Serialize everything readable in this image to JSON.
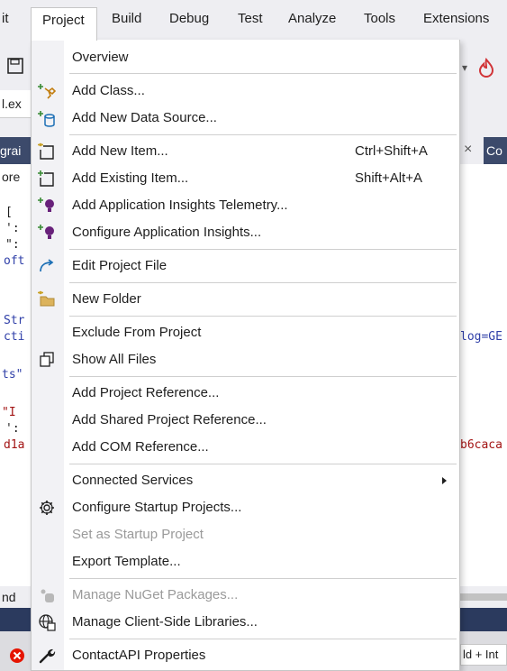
{
  "menubar": {
    "items": [
      "it",
      "Project",
      "Build",
      "Debug",
      "Test",
      "Analyze",
      "Tools",
      "Extensions"
    ],
    "active": "Project"
  },
  "background": {
    "tab_fragment": "l.ex",
    "gra_fragment": "grai",
    "ore_fragment": "ore",
    "right_tab": "Co",
    "code_left": [
      "[",
      "':",
      "\":",
      "oft",
      "Str",
      "cti",
      "ts\"",
      " \"I",
      "':",
      "d1a"
    ],
    "code_right": [
      "log=GE",
      "b6caca"
    ],
    "nd": "nd",
    "bottom_right": "ld + Int"
  },
  "menu": {
    "items": [
      {
        "label": "Overview",
        "icon": "none",
        "shortcut": "",
        "disabled": false
      },
      {
        "label": "Add Class...",
        "icon": "add-class-icon",
        "shortcut": "",
        "disabled": false
      },
      {
        "label": "Add New Data Source...",
        "icon": "add-data-source-icon",
        "shortcut": "",
        "disabled": false
      },
      {
        "label": "Add New Item...",
        "icon": "add-new-item-icon",
        "shortcut": "Ctrl+Shift+A",
        "disabled": false
      },
      {
        "label": "Add Existing Item...",
        "icon": "add-existing-item-icon",
        "shortcut": "Shift+Alt+A",
        "disabled": false
      },
      {
        "label": "Add Application Insights Telemetry...",
        "icon": "app-insights-icon",
        "shortcut": "",
        "disabled": false
      },
      {
        "label": "Configure Application Insights...",
        "icon": "app-insights-config-icon",
        "shortcut": "",
        "disabled": false
      },
      {
        "label": "Edit Project File",
        "icon": "edit-project-file-icon",
        "shortcut": "",
        "disabled": false
      },
      {
        "label": "New Folder",
        "icon": "new-folder-icon",
        "shortcut": "",
        "disabled": false
      },
      {
        "label": "Exclude From Project",
        "icon": "none",
        "shortcut": "",
        "disabled": false
      },
      {
        "label": "Show All Files",
        "icon": "show-all-files-icon",
        "shortcut": "",
        "disabled": false
      },
      {
        "label": "Add Project Reference...",
        "icon": "none",
        "shortcut": "",
        "disabled": false
      },
      {
        "label": "Add Shared Project Reference...",
        "icon": "none",
        "shortcut": "",
        "disabled": false
      },
      {
        "label": "Add COM Reference...",
        "icon": "none",
        "shortcut": "",
        "disabled": false
      },
      {
        "label": "Connected Services",
        "icon": "none",
        "shortcut": "",
        "disabled": false,
        "submenu": true
      },
      {
        "label": "Configure Startup Projects...",
        "icon": "gear-icon",
        "shortcut": "",
        "disabled": false
      },
      {
        "label": "Set as Startup Project",
        "icon": "none",
        "shortcut": "",
        "disabled": true
      },
      {
        "label": "Export Template...",
        "icon": "none",
        "shortcut": "",
        "disabled": false
      },
      {
        "label": "Manage NuGet Packages...",
        "icon": "nuget-icon",
        "shortcut": "",
        "disabled": true
      },
      {
        "label": "Manage Client-Side Libraries...",
        "icon": "client-libraries-icon",
        "shortcut": "",
        "disabled": false
      },
      {
        "label": "ContactAPI Properties",
        "icon": "wrench-icon",
        "shortcut": "",
        "disabled": false
      }
    ]
  },
  "colors": {
    "accent_purple": "#68217a",
    "nuget_blue": "#004880",
    "menu_bg": "#ffffff",
    "icon_column": "#f2f2f5",
    "disabled_text": "#9a9a9a",
    "error_red": "#e51400"
  }
}
